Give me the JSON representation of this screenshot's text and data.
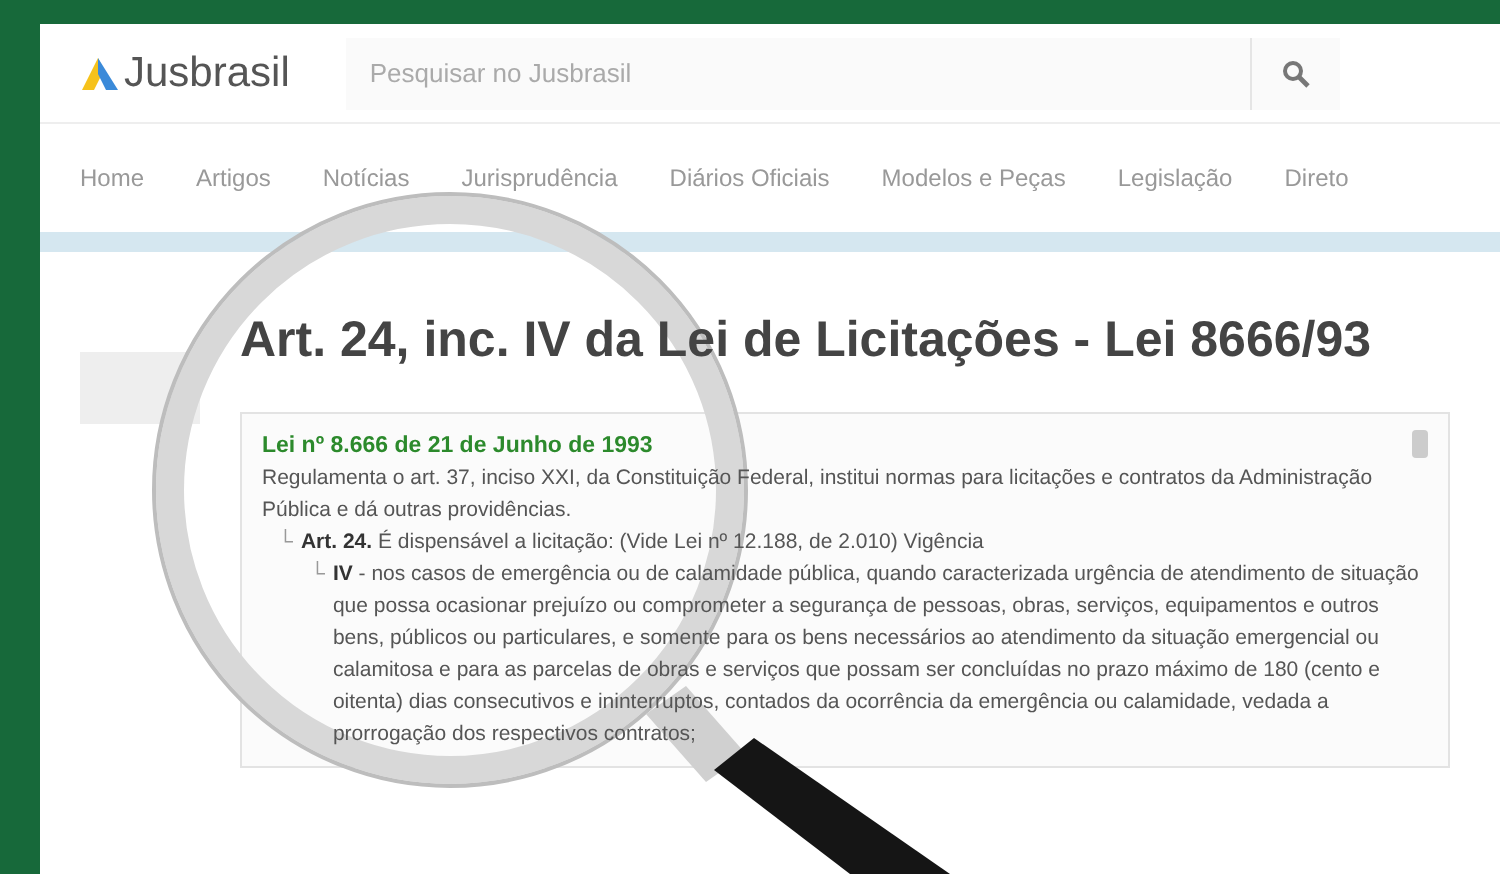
{
  "header": {
    "logo": "Jusbrasil",
    "search": {
      "placeholder": "Pesquisar no Jusbrasil"
    }
  },
  "nav": [
    {
      "label": "Home"
    },
    {
      "label": "Artigos"
    },
    {
      "label": "Notícias"
    },
    {
      "label": "Jurisprudência"
    },
    {
      "label": "Diários Oficiais"
    },
    {
      "label": "Modelos e Peças"
    },
    {
      "label": "Legislação"
    },
    {
      "label": "Direto"
    }
  ],
  "title": "Art. 24, inc. IV da Lei de Licitações - Lei 8666/93",
  "card": {
    "law_title": "Lei nº 8.666 de 21 de Junho de 1993",
    "summary": "Regulamenta o art. 37, inciso XXI, da Constituição Federal, institui normas para licitações e contratos da Administração Pública e dá outras providências.",
    "article": {
      "marker": "└",
      "label": "Art. 24.",
      "text": "É dispensável a licitação: (Vide Lei nº 12.188, de 2.010) Vigência"
    },
    "item": {
      "marker": "└",
      "label": "IV",
      "text": "- nos casos de emergência ou de calamidade pública, quando caracterizada urgência de atendimento de situação que possa ocasionar prejuízo ou comprometer a segurança de pessoas, obras, serviços, equipamentos e outros bens, públicos ou particulares, e somente para os bens necessários ao atendimento da situação emergencial ou calamitosa e para as parcelas de obras e serviços que possam ser concluídas no prazo máximo de 180 (cento e oitenta) dias consecutivos e ininterruptos, contados da ocorrência da emergência ou calamidade, vedada a prorrogação dos respectivos contratos;"
    }
  }
}
